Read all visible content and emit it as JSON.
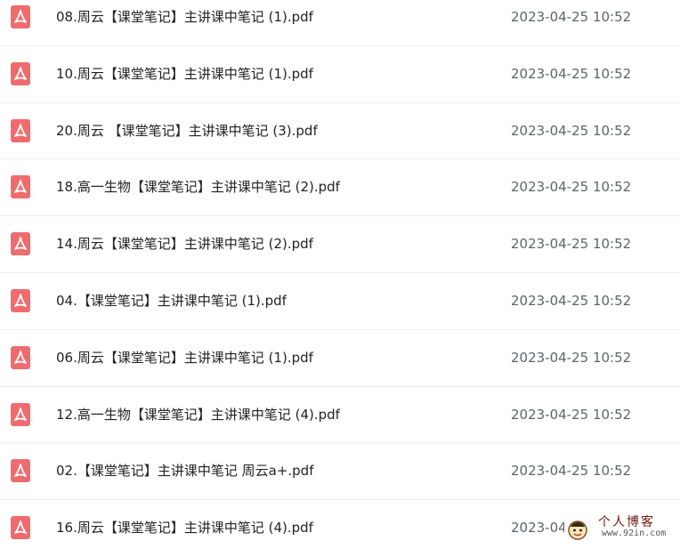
{
  "colors": {
    "pdf_icon": "#f06b6e",
    "text": "#222222",
    "date": "#5f6368",
    "divider": "#eeeeee"
  },
  "files": [
    {
      "name": "08.周云【课堂笔记】主讲课中笔记 (1).pdf",
      "date": "2023-04-25 10:52",
      "icon": "pdf-file-icon"
    },
    {
      "name": "10.周云【课堂笔记】主讲课中笔记 (1).pdf",
      "date": "2023-04-25 10:52",
      "icon": "pdf-file-icon"
    },
    {
      "name": "20.周云 【课堂笔记】主讲课中笔记 (3).pdf",
      "date": "2023-04-25 10:52",
      "icon": "pdf-file-icon"
    },
    {
      "name": "18.高一生物【课堂笔记】主讲课中笔记 (2).pdf",
      "date": "2023-04-25 10:52",
      "icon": "pdf-file-icon"
    },
    {
      "name": "14.周云【课堂笔记】主讲课中笔记 (2).pdf",
      "date": "2023-04-25 10:52",
      "icon": "pdf-file-icon"
    },
    {
      "name": "04.【课堂笔记】主讲课中笔记 (1).pdf",
      "date": "2023-04-25 10:52",
      "icon": "pdf-file-icon"
    },
    {
      "name": "06.周云【课堂笔记】主讲课中笔记 (1).pdf",
      "date": "2023-04-25 10:52",
      "icon": "pdf-file-icon"
    },
    {
      "name": "12.高一生物【课堂笔记】主讲课中笔记 (4).pdf",
      "date": "2023-04-25 10:52",
      "icon": "pdf-file-icon"
    },
    {
      "name": "02.【课堂笔记】主讲课中笔记 周云a+.pdf",
      "date": "2023-04-25 10:52",
      "icon": "pdf-file-icon"
    },
    {
      "name": "16.周云【课堂笔记】主讲课中笔记 (4).pdf",
      "date": "2023-04",
      "icon": "pdf-file-icon"
    }
  ],
  "watermark": {
    "title": "个人博客",
    "url": "www.92in.com"
  }
}
